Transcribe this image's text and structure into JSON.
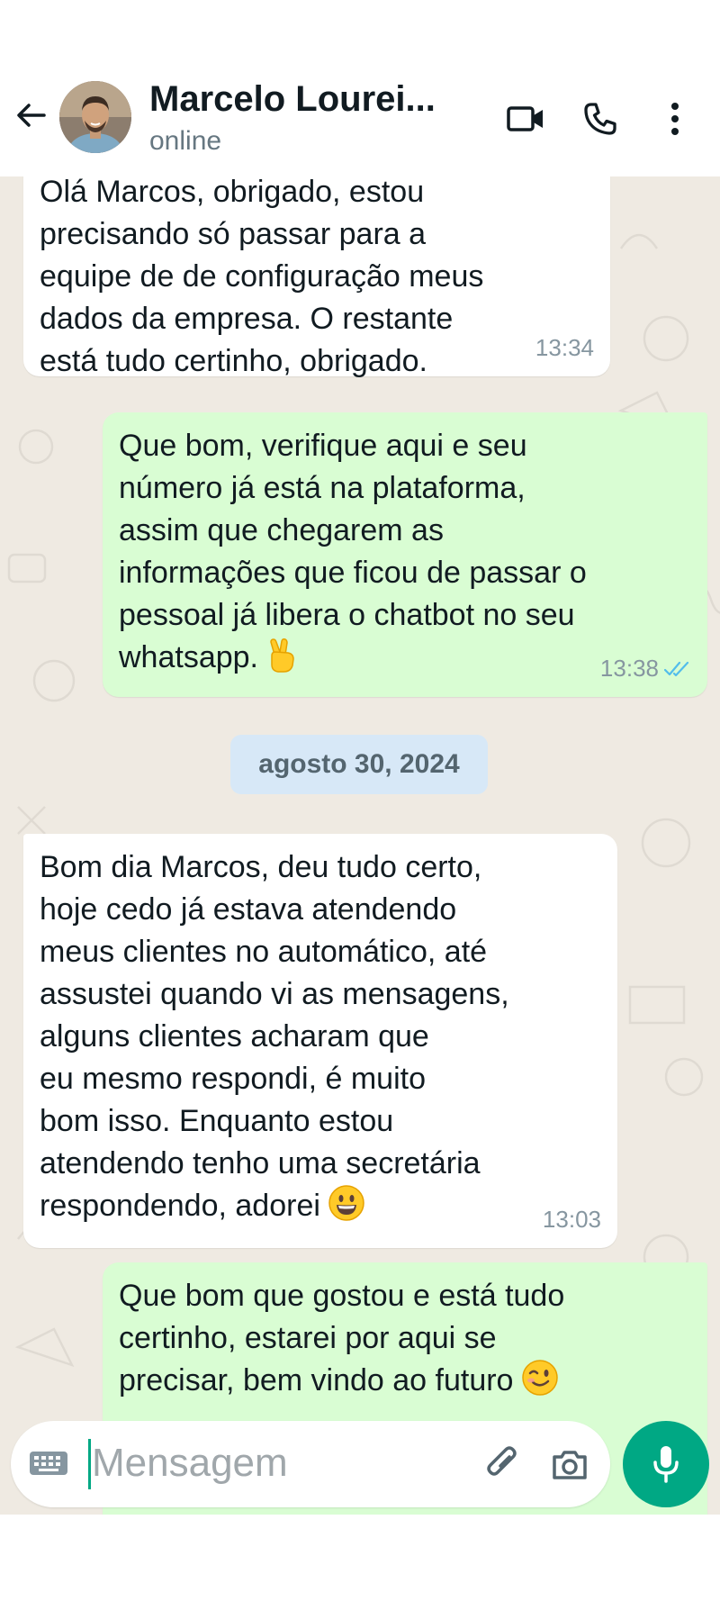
{
  "header": {
    "contact_name": "Marcelo Lourei...",
    "status": "online",
    "icons": [
      "back-arrow-icon",
      "video-call-icon",
      "voice-call-icon",
      "more-options-icon"
    ]
  },
  "colors": {
    "incoming_bubble": "#ffffff",
    "outgoing_bubble": "#d9fdd3",
    "chat_background": "#efeae2",
    "date_chip": "#d7e8f7",
    "accent": "#00a884",
    "read_ticks": "#53bdeb"
  },
  "messages": [
    {
      "direction": "incoming",
      "text": "Olá Marcos, obrigado, estou\nprecisando só passar para a\nequipe de de configuração meus\ndados da empresa. O restante\nestá tudo certinho, obrigado.",
      "time": "13:34"
    },
    {
      "direction": "outgoing",
      "text": "Que bom, verifique aqui e seu\nnúmero já está na plataforma,\nassim que chegarem as\ninformações que ficou de passar o\npessoal já libera o chatbot no seu\nwhatsapp.",
      "emoji": "victory-hand",
      "time": "13:38",
      "status": "read"
    },
    {
      "direction": "incoming",
      "text": "Bom dia Marcos, deu tudo certo,\nhoje cedo já estava atendendo\nmeus clientes no automático, até\nassustei quando vi as mensagens,\nalguns clientes acharam que\neu mesmo respondi, é muito\nbom isso. Enquanto estou\natendendo tenho uma secretária\nrespondendo, adorei",
      "emoji": "grinning-face",
      "time": "13:03"
    },
    {
      "direction": "outgoing",
      "text": "Que bom que gostou e está tudo\ncertinho, estarei por aqui se\nprecisar, bem vindo ao futuro",
      "emoji": "winking-face"
    }
  ],
  "date_separator": "agosto 30, 2024",
  "composer": {
    "placeholder": "Mensagem",
    "icons": [
      "keyboard-icon",
      "attach-icon",
      "camera-icon",
      "mic-icon"
    ]
  }
}
